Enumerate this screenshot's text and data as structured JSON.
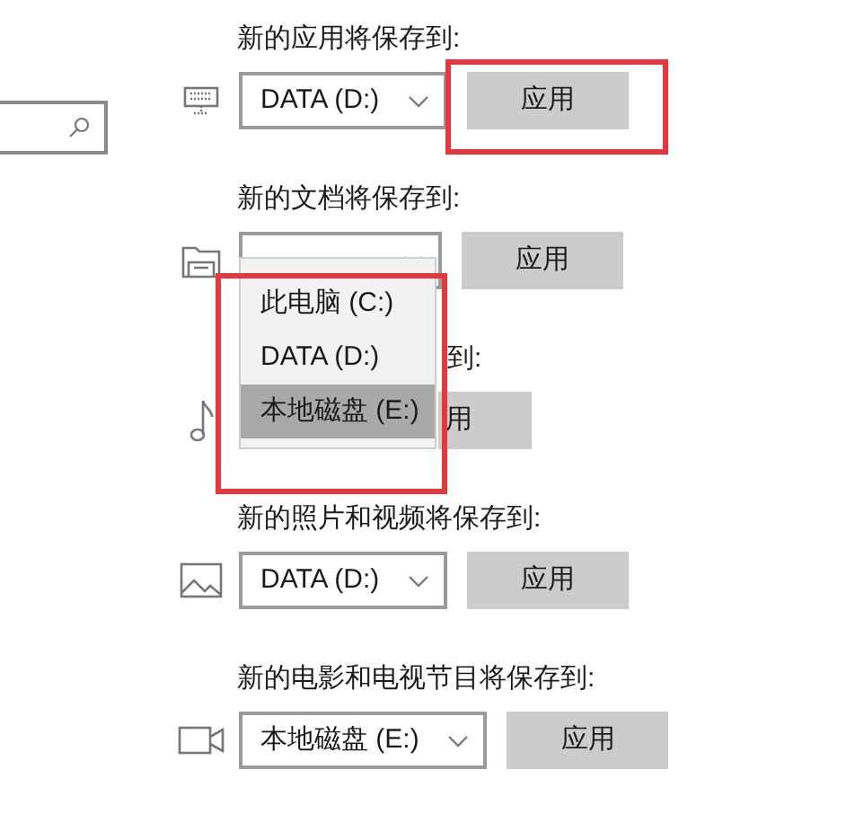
{
  "sections": [
    {
      "kind": "monitor",
      "label": "新的应用将保存到:",
      "drive": "DATA (D:)",
      "button": "应用",
      "covered": false
    },
    {
      "kind": "folder",
      "label": "新的文档将保存到:",
      "button": "应用",
      "covered": false
    },
    {
      "kind": "music",
      "label": "到:",
      "button": "用",
      "covered": true
    },
    {
      "kind": "image",
      "label": "新的照片和视频将保存到:",
      "drive": "DATA (D:)",
      "button": "应用",
      "covered": false
    },
    {
      "kind": "video",
      "label": "新的电影和电视节目将保存到:",
      "drive": "本地磁盘 (E:)",
      "button": "应用",
      "covered": false
    }
  ],
  "dropdown": {
    "items": [
      {
        "label": "此电脑 (C:)",
        "selected": false
      },
      {
        "label": "DATA (D:)",
        "selected": false
      },
      {
        "label": "本地磁盘 (E:)",
        "selected": true
      }
    ]
  }
}
